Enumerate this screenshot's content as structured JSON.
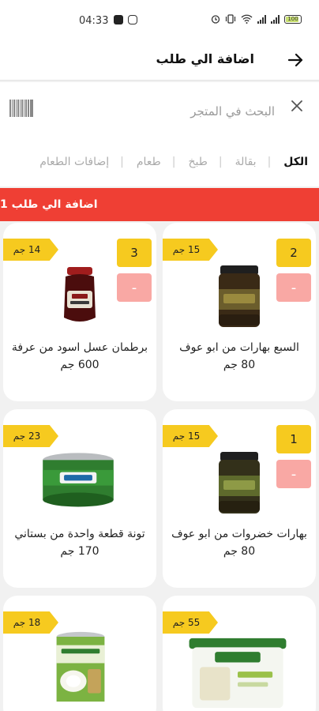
{
  "status_bar": {
    "time": "04:33",
    "battery": "100",
    "app_icons": [
      "notification-app-icon",
      "instagram-icon"
    ],
    "system_icons": [
      "alarm-icon",
      "vibrate-icon",
      "wifi-icon",
      "signal-icon",
      "signal-icon",
      "battery-icon"
    ]
  },
  "header": {
    "title": "اضافة الي طلب",
    "back_icon": "arrow-right-icon"
  },
  "search": {
    "placeholder": "البحث في المتجر",
    "barcode_icon": "barcode-icon",
    "clear_icon": "close-icon"
  },
  "categories": [
    {
      "label": "الكل",
      "active": true
    },
    {
      "label": "بقالة",
      "active": false
    },
    {
      "label": "طبخ",
      "active": false
    },
    {
      "label": "طعام",
      "active": false
    },
    {
      "label": "إضافات الطعام",
      "active": false
    }
  ],
  "banner": {
    "text": "اضافة الي طلب 1",
    "color": "#ef3f34"
  },
  "colors": {
    "accent": "#f6ca1f",
    "remove": "#f9a8a4",
    "banner": "#ef3f34"
  },
  "products": [
    {
      "name": "السبع بهارات من ابو عوف 80 جم",
      "price": "15 جم",
      "quantity": "2",
      "minus": "-",
      "image": "spice-jar"
    },
    {
      "name": "برطمان عسل اسود من عرفة 600 جم",
      "price": "14 جم",
      "quantity": "3",
      "minus": "-",
      "image": "molasses-jar"
    },
    {
      "name": "بهارات خضروات من ابو عوف 80 جم",
      "price": "15 جم",
      "quantity": "1",
      "minus": "-",
      "image": "spice-jar"
    },
    {
      "name": "تونة قطعة واحدة من بستاني 170 جم",
      "price": "23 جم",
      "image": "tuna-can"
    },
    {
      "name": "",
      "price": "55 جم",
      "image": "cheese-tub"
    },
    {
      "name": "",
      "price": "18 جم",
      "image": "coconut-milk-can"
    }
  ]
}
